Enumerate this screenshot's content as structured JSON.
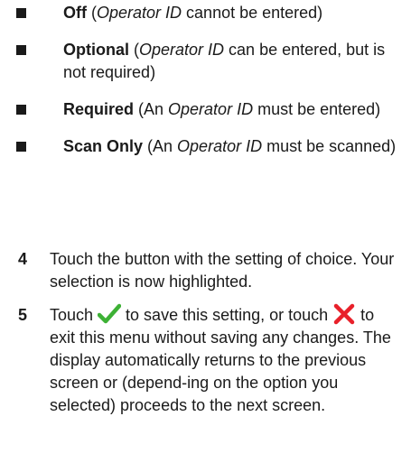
{
  "options": [
    {
      "name": "Off",
      "open": " (",
      "italic": "Operator ID",
      "rest": " cannot be entered)"
    },
    {
      "name": "Optional",
      "open": " (",
      "italic": "Operator ID",
      "rest": " can be entered, but is not required)"
    },
    {
      "name": "Required",
      "open": " (An ",
      "italic": "Operator ID",
      "rest": " must be entered)"
    },
    {
      "name": "Scan Only",
      "open": " (An ",
      "italic": "Operator ID",
      "rest": " must be scanned)"
    }
  ],
  "steps": {
    "step4": {
      "number": "4",
      "text": "Touch the button with the setting of choice. Your selection is now highlighted."
    },
    "step5": {
      "number": "5",
      "text_a": "Touch ",
      "text_b": " to save this setting, or touch ",
      "text_c": " to exit this menu without saving any changes. The display automatically returns to the previous screen or (depend-ing on the option you selected) proceeds to the next screen."
    }
  },
  "icons": {
    "confirm": "checkmark-icon",
    "cancel": "x-cross-icon",
    "confirm_color": "#3db135",
    "cancel_color": "#e8202a"
  }
}
